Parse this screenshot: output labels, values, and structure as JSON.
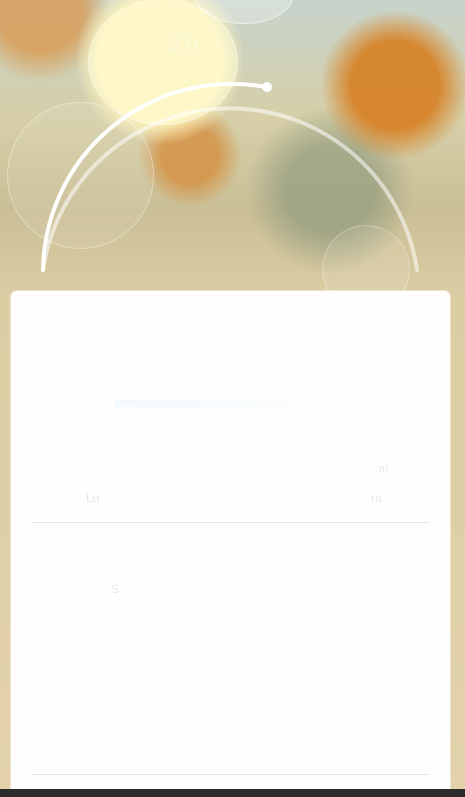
{
  "watermark": {
    "text": "Zh"
  },
  "hero": {
    "arc_color": "#ffffff",
    "accent_color": "#ffffff"
  },
  "panel": {
    "ghost_left": "Lo",
    "ghost_right": "ra",
    "ghost_mid": "S",
    "ghost_mini": "m"
  },
  "colors": {
    "panel": "#fefefe",
    "background_top": "#c7d4cc",
    "background_bottom": "#e3d2ab",
    "bottom_bar": "#2b2b2b"
  }
}
